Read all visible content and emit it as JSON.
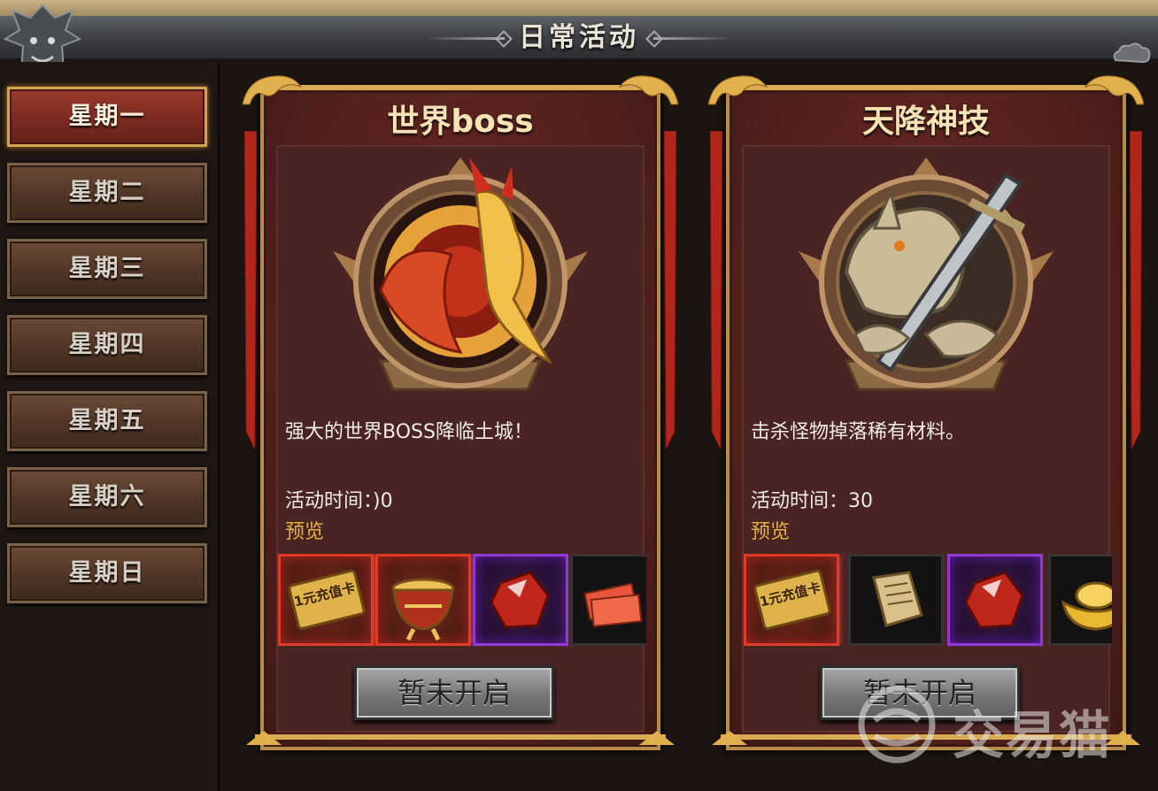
{
  "window": {
    "title": "日常活动"
  },
  "sidebar": {
    "days": [
      {
        "label": "星期一",
        "active": true
      },
      {
        "label": "星期二",
        "active": false
      },
      {
        "label": "星期三",
        "active": false
      },
      {
        "label": "星期四",
        "active": false
      },
      {
        "label": "星期五",
        "active": false
      },
      {
        "label": "星期六",
        "active": false
      },
      {
        "label": "星期日",
        "active": false
      }
    ]
  },
  "activities": [
    {
      "title": "世界boss",
      "emblem_icon": "fire-dragon-icon",
      "description": "强大的世界BOSS降临土城！",
      "time_label": "活动时间：",
      "time_value": ")0",
      "preview_label": "预览",
      "rewards": [
        {
          "icon": "recharge-card-icon",
          "text": "1元充值卡",
          "rarity": "red"
        },
        {
          "icon": "golden-cauldron-icon",
          "rarity": "red"
        },
        {
          "icon": "red-gem-icon",
          "rarity": "purple"
        },
        {
          "icon": "paper-tickets-icon",
          "rarity": "dark"
        }
      ],
      "button_label": "暂未开启"
    },
    {
      "title": "天降神技",
      "emblem_icon": "stone-dragon-sword-icon",
      "description": "击杀怪物掉落稀有材料。",
      "time_label": "活动时间：",
      "time_value": "30",
      "preview_label": "预览",
      "rewards": [
        {
          "icon": "recharge-card-icon",
          "text": "1元充值卡",
          "rarity": "red"
        },
        {
          "icon": "scroll-icon",
          "rarity": "dark"
        },
        {
          "icon": "red-gem-icon",
          "rarity": "purple"
        },
        {
          "icon": "gold-ingot-icon",
          "rarity": "dark"
        }
      ],
      "button_label": "暂未开启"
    }
  ],
  "watermark": {
    "text": "交易猫"
  },
  "colors": {
    "accent_gold": "#d4a44c",
    "active_tab": "#8a3224",
    "card_red": "#5a2220",
    "preview_gold": "#e6b33c"
  }
}
